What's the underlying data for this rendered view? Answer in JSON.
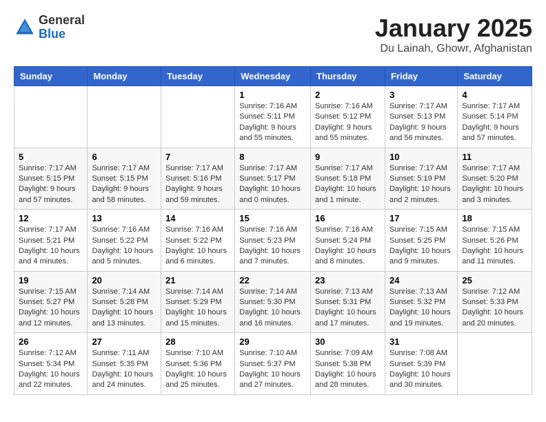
{
  "logo": {
    "general": "General",
    "blue": "Blue"
  },
  "title": "January 2025",
  "subtitle": "Du Lainah, Ghowr, Afghanistan",
  "headers": [
    "Sunday",
    "Monday",
    "Tuesday",
    "Wednesday",
    "Thursday",
    "Friday",
    "Saturday"
  ],
  "weeks": [
    [
      {
        "day": "",
        "sunrise": "",
        "sunset": "",
        "daylight": ""
      },
      {
        "day": "",
        "sunrise": "",
        "sunset": "",
        "daylight": ""
      },
      {
        "day": "",
        "sunrise": "",
        "sunset": "",
        "daylight": ""
      },
      {
        "day": "1",
        "sunrise": "Sunrise: 7:16 AM",
        "sunset": "Sunset: 5:11 PM",
        "daylight": "Daylight: 9 hours and 55 minutes."
      },
      {
        "day": "2",
        "sunrise": "Sunrise: 7:16 AM",
        "sunset": "Sunset: 5:12 PM",
        "daylight": "Daylight: 9 hours and 55 minutes."
      },
      {
        "day": "3",
        "sunrise": "Sunrise: 7:17 AM",
        "sunset": "Sunset: 5:13 PM",
        "daylight": "Daylight: 9 hours and 56 minutes."
      },
      {
        "day": "4",
        "sunrise": "Sunrise: 7:17 AM",
        "sunset": "Sunset: 5:14 PM",
        "daylight": "Daylight: 9 hours and 57 minutes."
      }
    ],
    [
      {
        "day": "5",
        "sunrise": "Sunrise: 7:17 AM",
        "sunset": "Sunset: 5:15 PM",
        "daylight": "Daylight: 9 hours and 57 minutes."
      },
      {
        "day": "6",
        "sunrise": "Sunrise: 7:17 AM",
        "sunset": "Sunset: 5:15 PM",
        "daylight": "Daylight: 9 hours and 58 minutes."
      },
      {
        "day": "7",
        "sunrise": "Sunrise: 7:17 AM",
        "sunset": "Sunset: 5:16 PM",
        "daylight": "Daylight: 9 hours and 59 minutes."
      },
      {
        "day": "8",
        "sunrise": "Sunrise: 7:17 AM",
        "sunset": "Sunset: 5:17 PM",
        "daylight": "Daylight: 10 hours and 0 minutes."
      },
      {
        "day": "9",
        "sunrise": "Sunrise: 7:17 AM",
        "sunset": "Sunset: 5:18 PM",
        "daylight": "Daylight: 10 hours and 1 minute."
      },
      {
        "day": "10",
        "sunrise": "Sunrise: 7:17 AM",
        "sunset": "Sunset: 5:19 PM",
        "daylight": "Daylight: 10 hours and 2 minutes."
      },
      {
        "day": "11",
        "sunrise": "Sunrise: 7:17 AM",
        "sunset": "Sunset: 5:20 PM",
        "daylight": "Daylight: 10 hours and 3 minutes."
      }
    ],
    [
      {
        "day": "12",
        "sunrise": "Sunrise: 7:17 AM",
        "sunset": "Sunset: 5:21 PM",
        "daylight": "Daylight: 10 hours and 4 minutes."
      },
      {
        "day": "13",
        "sunrise": "Sunrise: 7:16 AM",
        "sunset": "Sunset: 5:22 PM",
        "daylight": "Daylight: 10 hours and 5 minutes."
      },
      {
        "day": "14",
        "sunrise": "Sunrise: 7:16 AM",
        "sunset": "Sunset: 5:22 PM",
        "daylight": "Daylight: 10 hours and 6 minutes."
      },
      {
        "day": "15",
        "sunrise": "Sunrise: 7:16 AM",
        "sunset": "Sunset: 5:23 PM",
        "daylight": "Daylight: 10 hours and 7 minutes."
      },
      {
        "day": "16",
        "sunrise": "Sunrise: 7:16 AM",
        "sunset": "Sunset: 5:24 PM",
        "daylight": "Daylight: 10 hours and 8 minutes."
      },
      {
        "day": "17",
        "sunrise": "Sunrise: 7:15 AM",
        "sunset": "Sunset: 5:25 PM",
        "daylight": "Daylight: 10 hours and 9 minutes."
      },
      {
        "day": "18",
        "sunrise": "Sunrise: 7:15 AM",
        "sunset": "Sunset: 5:26 PM",
        "daylight": "Daylight: 10 hours and 11 minutes."
      }
    ],
    [
      {
        "day": "19",
        "sunrise": "Sunrise: 7:15 AM",
        "sunset": "Sunset: 5:27 PM",
        "daylight": "Daylight: 10 hours and 12 minutes."
      },
      {
        "day": "20",
        "sunrise": "Sunrise: 7:14 AM",
        "sunset": "Sunset: 5:28 PM",
        "daylight": "Daylight: 10 hours and 13 minutes."
      },
      {
        "day": "21",
        "sunrise": "Sunrise: 7:14 AM",
        "sunset": "Sunset: 5:29 PM",
        "daylight": "Daylight: 10 hours and 15 minutes."
      },
      {
        "day": "22",
        "sunrise": "Sunrise: 7:14 AM",
        "sunset": "Sunset: 5:30 PM",
        "daylight": "Daylight: 10 hours and 16 minutes."
      },
      {
        "day": "23",
        "sunrise": "Sunrise: 7:13 AM",
        "sunset": "Sunset: 5:31 PM",
        "daylight": "Daylight: 10 hours and 17 minutes."
      },
      {
        "day": "24",
        "sunrise": "Sunrise: 7:13 AM",
        "sunset": "Sunset: 5:32 PM",
        "daylight": "Daylight: 10 hours and 19 minutes."
      },
      {
        "day": "25",
        "sunrise": "Sunrise: 7:12 AM",
        "sunset": "Sunset: 5:33 PM",
        "daylight": "Daylight: 10 hours and 20 minutes."
      }
    ],
    [
      {
        "day": "26",
        "sunrise": "Sunrise: 7:12 AM",
        "sunset": "Sunset: 5:34 PM",
        "daylight": "Daylight: 10 hours and 22 minutes."
      },
      {
        "day": "27",
        "sunrise": "Sunrise: 7:11 AM",
        "sunset": "Sunset: 5:35 PM",
        "daylight": "Daylight: 10 hours and 24 minutes."
      },
      {
        "day": "28",
        "sunrise": "Sunrise: 7:10 AM",
        "sunset": "Sunset: 5:36 PM",
        "daylight": "Daylight: 10 hours and 25 minutes."
      },
      {
        "day": "29",
        "sunrise": "Sunrise: 7:10 AM",
        "sunset": "Sunset: 5:37 PM",
        "daylight": "Daylight: 10 hours and 27 minutes."
      },
      {
        "day": "30",
        "sunrise": "Sunrise: 7:09 AM",
        "sunset": "Sunset: 5:38 PM",
        "daylight": "Daylight: 10 hours and 28 minutes."
      },
      {
        "day": "31",
        "sunrise": "Sunrise: 7:08 AM",
        "sunset": "Sunset: 5:39 PM",
        "daylight": "Daylight: 10 hours and 30 minutes."
      },
      {
        "day": "",
        "sunrise": "",
        "sunset": "",
        "daylight": ""
      }
    ]
  ]
}
